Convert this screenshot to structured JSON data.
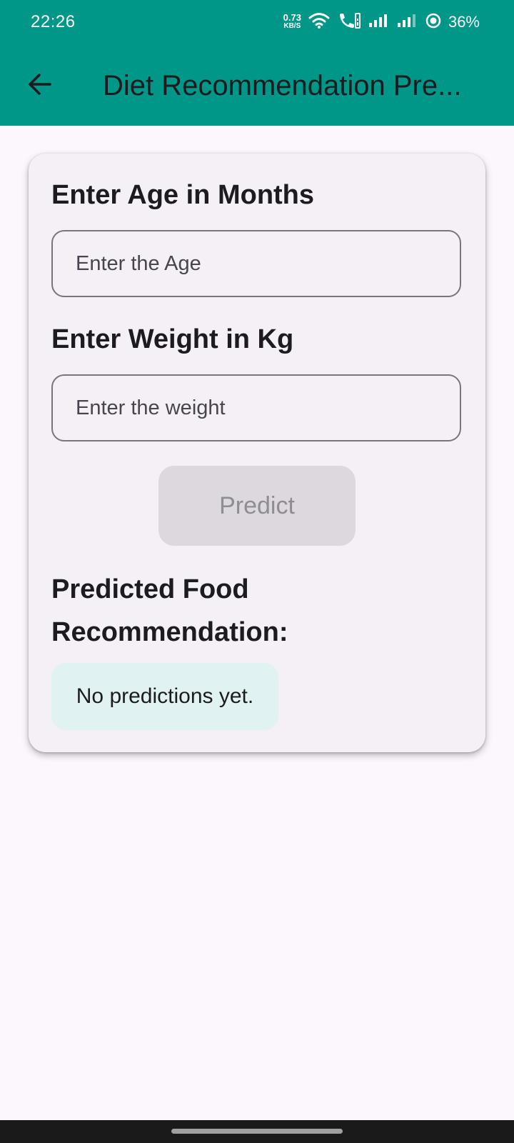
{
  "status_bar": {
    "time": "22:26",
    "net_speed_value": "0.73",
    "net_speed_unit": "KB/S",
    "battery": "36%",
    "icons": [
      "wifi-icon",
      "call-icon",
      "signal-icon",
      "signal-icon",
      "battery-ring-icon"
    ]
  },
  "app_bar": {
    "title": "Diet Recommendation Pre...",
    "back_icon": "arrow-back-icon",
    "color": "#009688"
  },
  "form": {
    "age_label": "Enter Age in Months",
    "age_placeholder": "Enter the Age",
    "weight_label": "Enter Weight in Kg",
    "weight_placeholder": "Enter the weight",
    "predict_label": "Predict"
  },
  "result": {
    "heading": "Predicted Food Recommendation:",
    "text": "No predictions yet.",
    "box_color": "#E0F2F1"
  }
}
